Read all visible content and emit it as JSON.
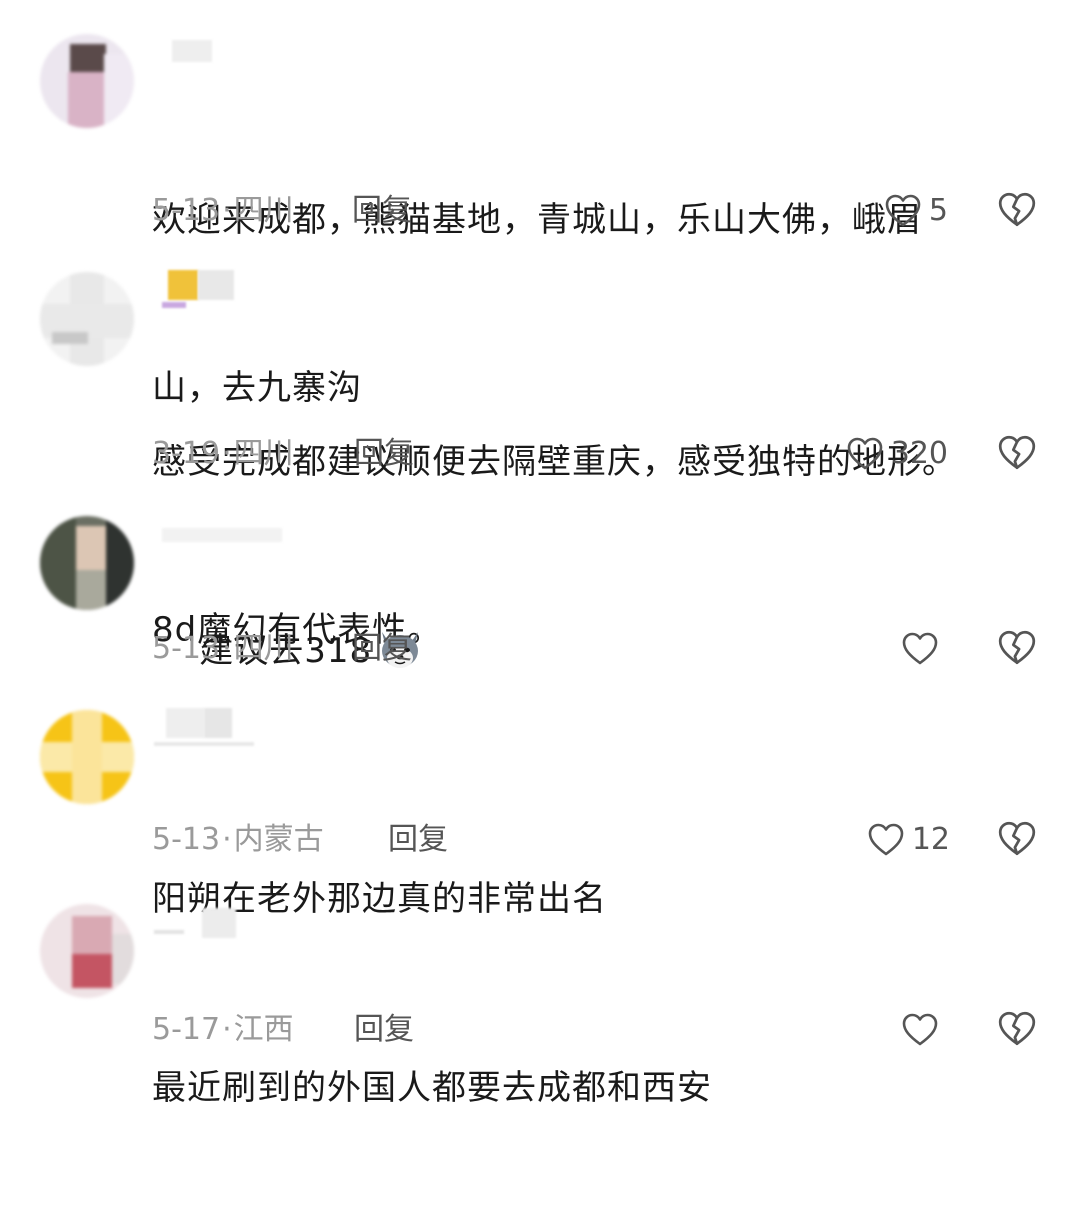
{
  "comments": [
    {
      "text": "欢迎来成都，熊猫基地，青城山，乐山大佛，峨眉山，去九寨沟",
      "line1": "欢迎来成都，熊猫基地，青城山，乐山大佛，峨眉",
      "line2": "山，去九寨沟",
      "date": "5-13",
      "region": "四川",
      "reply_label": "回复",
      "likes": "5"
    },
    {
      "text": "感受完成都建议顺便去隔壁重庆，感受独特的地形。8d魔幻有代表性。",
      "line1": "感受完成都建议顺便去隔壁重庆，感受独特的地形。",
      "line2": "8d魔幻有代表性。",
      "date": "3-19",
      "region": "四川",
      "reply_label": "回复",
      "likes": "320"
    },
    {
      "text": "建议去318",
      "emoji": "husky-emoji",
      "date": "5-13",
      "region": "四川",
      "reply_label": "回复",
      "likes": ""
    },
    {
      "text": "阳朔在老外那边真的非常出名",
      "date": "5-13",
      "region": "内蒙古",
      "reply_label": "回复",
      "likes": "12"
    },
    {
      "text": "最近刷到的外国人都要去成都和西安",
      "date": "5-17",
      "region": "江西",
      "reply_label": "回复",
      "likes": ""
    }
  ],
  "separator": "·",
  "icons": {
    "like": "heart-outline-icon",
    "dislike": "broken-heart-icon"
  },
  "colors": {
    "text": "#1a1a1a",
    "meta": "#9a9a9a",
    "reply": "#555555",
    "icon": "#555555"
  }
}
